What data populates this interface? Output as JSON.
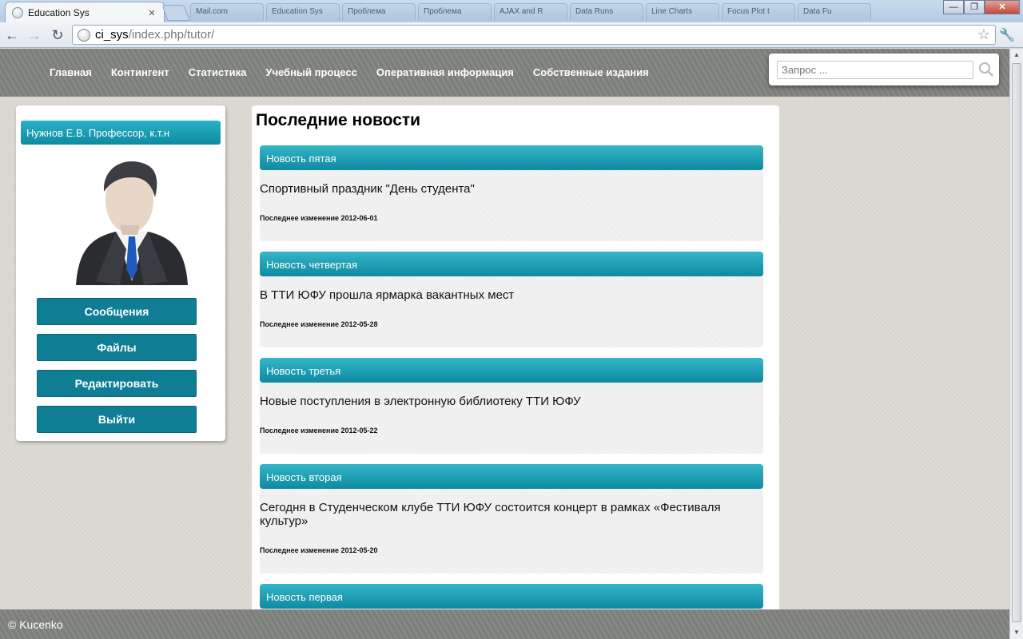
{
  "browser": {
    "tab_title": "Education Sys",
    "tab_close": "✕",
    "background_tabs": [
      "Mail.com",
      "Education Sys",
      "Проблема",
      "Проблема",
      "AJAX and R",
      "Data Runs",
      "Line Charts",
      "Focus Plot t",
      "Data Fu"
    ],
    "url_host": "ci_sys",
    "url_path": "/index.php/tutor/",
    "window_buttons": {
      "minimize": "—",
      "maximize": "❐",
      "close": "✕"
    }
  },
  "nav": {
    "items": [
      "Главная",
      "Контингент",
      "Статистика",
      "Учебный процесс",
      "Оперативная информация",
      "Собственные издания"
    ],
    "search_placeholder": "Запрос ..."
  },
  "sidebar": {
    "user": "Нужнов Е.В. Профессор, к.т.н",
    "buttons": [
      "Сообщения",
      "Файлы",
      "Редактировать",
      "Выйти"
    ]
  },
  "content": {
    "title": "Последние новости",
    "news": [
      {
        "header": "Новость пятая",
        "text": "Спортивный праздник \"День студента\"",
        "date": "Последнее изменение 2012-06-01"
      },
      {
        "header": "Новость четвертая",
        "text": "В ТТИ ЮФУ прошла ярмарка вакантных мест",
        "date": "Последнее изменение 2012-05-28"
      },
      {
        "header": "Новость третья",
        "text": "Новые поступления в электронную библиотеку ТТИ ЮФУ",
        "date": "Последнее изменение 2012-05-22"
      },
      {
        "header": "Новость вторая",
        "text": "Сегодня в Студенческом клубе ТТИ ЮФУ состоится концерт в рамках «Фестиваля культур»",
        "date": "Последнее изменение 2012-05-20"
      },
      {
        "header": "Новость первая",
        "text": "",
        "date": ""
      }
    ]
  },
  "footer": {
    "copyright": "© Kucenko"
  },
  "colors": {
    "accent": "#0f7e95",
    "header_gradient_top": "#36b6c9",
    "nav_bg": "#7b7e7a"
  }
}
